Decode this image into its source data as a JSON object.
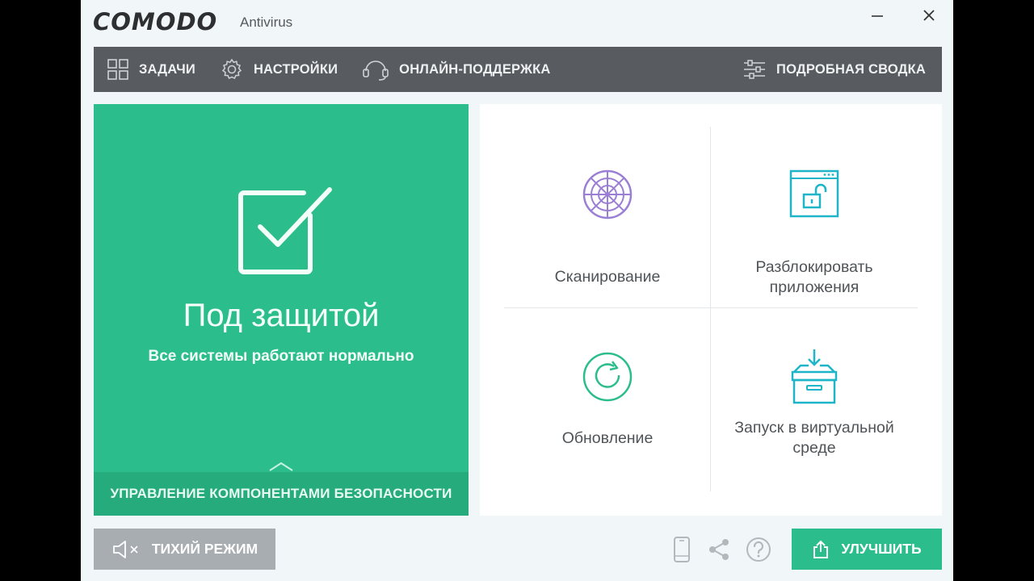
{
  "app": {
    "logo": "COMODO",
    "product": "Antivirus"
  },
  "menu": {
    "tasks": "ЗАДАЧИ",
    "settings": "НАСТРОЙКИ",
    "support": "ОНЛАЙН-ПОДДЕРЖКА",
    "summary": "ПОДРОБНАЯ СВОДКА"
  },
  "status": {
    "title": "Под защитой",
    "subtitle": "Все системы работают нормально",
    "manage": "УПРАВЛЕНИЕ КОМПОНЕНТАМИ БЕЗОПАСНОСТИ"
  },
  "tasks": {
    "scan": "Сканирование",
    "unblock_line1": "Разблокировать",
    "unblock_line2": "приложения",
    "update": "Обновление",
    "sandbox_line1": "Запуск в виртуальной",
    "sandbox_line2": "среде"
  },
  "footer": {
    "silent_mode": "ТИХИЙ РЕЖИМ",
    "upgrade": "УЛУЧШИТЬ"
  },
  "colors": {
    "accent_green": "#2cbd8c",
    "menubar": "#585c61",
    "scan_purple": "#9b7fd4",
    "cyan": "#1fb5c9"
  }
}
